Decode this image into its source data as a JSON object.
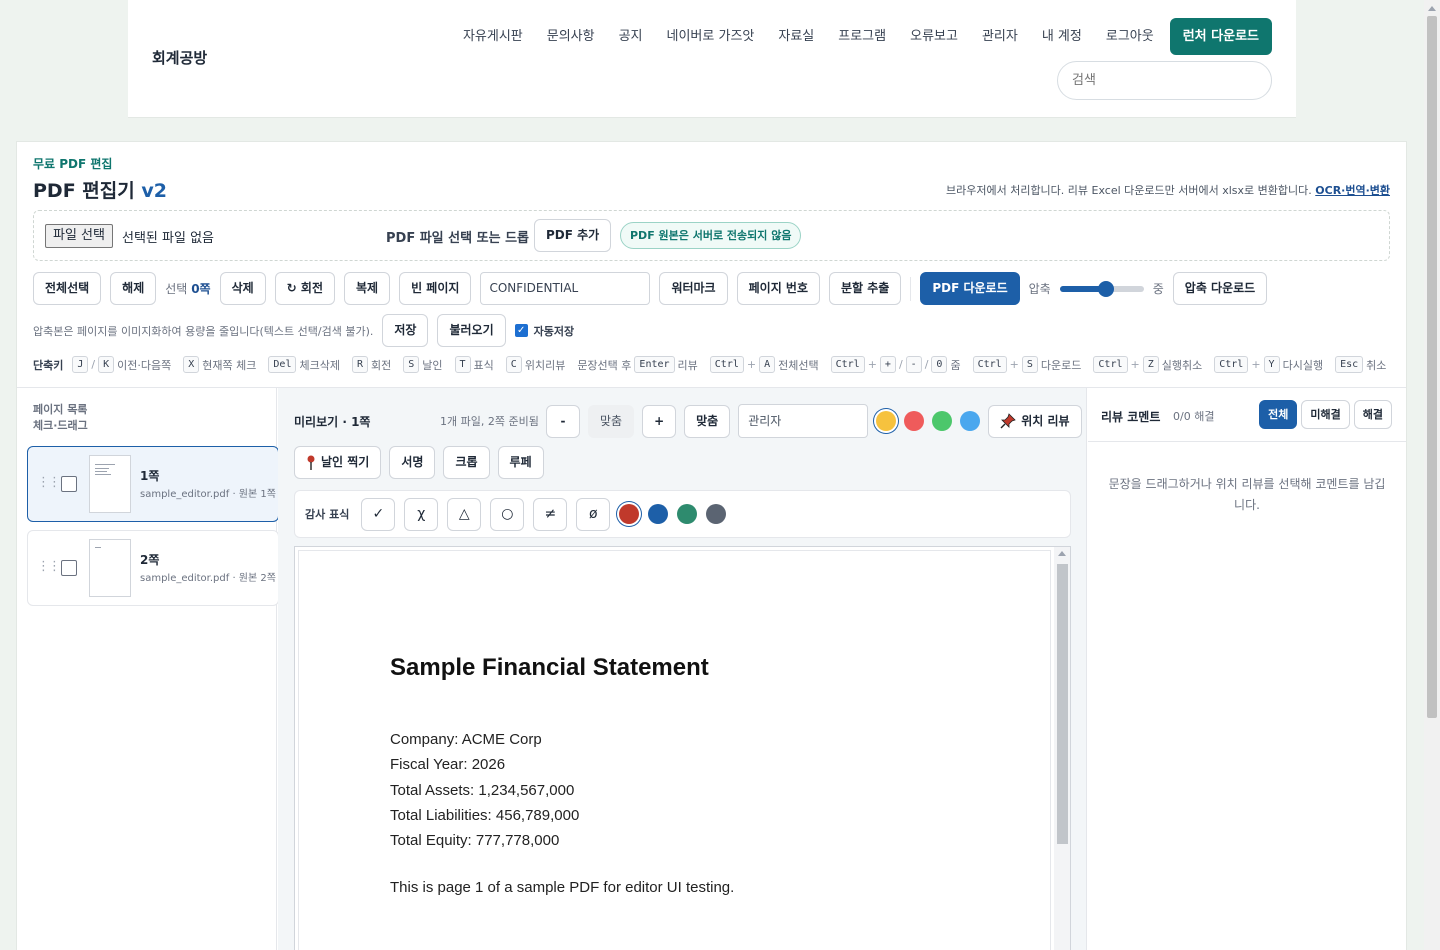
{
  "site": {
    "brand": "회계공방",
    "nav": [
      "자유게시판",
      "문의사항",
      "공지",
      "네이버로 가즈앗",
      "자료실",
      "프로그램",
      "오류보고",
      "관리자",
      "내 계정",
      "로그아웃"
    ],
    "cta": "런처 다운로드",
    "search_placeholder": "검색"
  },
  "header": {
    "eyebrow": "무료 PDF 편집",
    "title": "PDF 편집기",
    "version": "v2",
    "note": "브라우저에서 처리합니다. 리뷰 Excel 다운로드만 서버에서 xlsx로 변환합니다.",
    "note_link": "OCR·번역·변환"
  },
  "dropzone": {
    "file_button": "파일 선택",
    "file_status": "선택된 파일 없음",
    "label": "PDF 파일 선택 또는 드롭",
    "add_button": "PDF 추가",
    "secure_badge": "PDF 원본은 서버로 전송되지 않음"
  },
  "toolbar": {
    "select_all": "전체선택",
    "deselect": "해제",
    "selected_prefix": "선택",
    "selected_count": "0쪽",
    "delete": "삭제",
    "rotate": "↻ 회전",
    "duplicate": "복제",
    "blank_page": "빈 페이지",
    "watermark_value": "CONFIDENTIAL",
    "watermark": "워터마크",
    "page_number": "페이지 번호",
    "split": "분할 추출",
    "download": "PDF 다운로드",
    "compress_label": "압축",
    "compress_value": 0.55,
    "compress_level": "중",
    "compress_download": "압축 다운로드",
    "compress_note": "압축본은 페이지를 이미지화하여 용량을 줄입니다(텍스트 선택/검색 불가).",
    "save": "저장",
    "load": "불러오기",
    "autosave": "자동저장",
    "autosave_checked": true
  },
  "shortcuts": {
    "label": "단축키",
    "items": [
      {
        "keys": [
          "J",
          "K"
        ],
        "joiner": "/",
        "text": "이전·다음쪽"
      },
      {
        "keys": [
          "X"
        ],
        "text": "현재쪽 체크"
      },
      {
        "keys": [
          "Del"
        ],
        "text": "체크삭제"
      },
      {
        "keys": [
          "R"
        ],
        "text": "회전"
      },
      {
        "keys": [
          "S"
        ],
        "text": "날인"
      },
      {
        "keys": [
          "T"
        ],
        "text": "표식"
      },
      {
        "keys": [
          "C"
        ],
        "text": "위치리뷰"
      },
      {
        "prefix": "문장선택 후",
        "keys": [
          "Enter"
        ],
        "text": "리뷰"
      },
      {
        "keys": [
          "Ctrl",
          "A"
        ],
        "joiner": "+",
        "text": "전체선택"
      },
      {
        "keys": [
          "Ctrl",
          "+",
          "-",
          "0"
        ],
        "joiner": "+//",
        "text": "줌"
      },
      {
        "keys": [
          "Ctrl",
          "S"
        ],
        "joiner": "+",
        "text": "다운로드"
      },
      {
        "keys": [
          "Ctrl",
          "Z"
        ],
        "joiner": "+",
        "text": "실행취소"
      },
      {
        "keys": [
          "Ctrl",
          "Y"
        ],
        "joiner": "+",
        "text": "다시실행"
      },
      {
        "keys": [
          "Esc"
        ],
        "text": "취소"
      }
    ]
  },
  "pages_panel": {
    "title": "페이지 목록",
    "subtitle": "체크·드래그",
    "pages": [
      {
        "name": "1쪽",
        "sub": "sample_editor.pdf · 원본 1쪽",
        "active": true
      },
      {
        "name": "2쪽",
        "sub": "sample_editor.pdf · 원본 2쪽",
        "active": false
      }
    ]
  },
  "preview": {
    "title": "미리보기 · 1쪽",
    "status": "1개 파일, 2쪽 준비됨",
    "zoom_out": "-",
    "fit": "맞춤",
    "zoom_in": "+",
    "fit2": "맞춤",
    "reviewer": "관리자",
    "colors": [
      "#f6c23e",
      "#ef5b5b",
      "#4cc76b",
      "#4aa7ee"
    ],
    "pin_review": "위치 리뷰",
    "tools": [
      "날인 찍기",
      "서명",
      "크롭",
      "루페"
    ],
    "audit_label": "감사 표식",
    "audit_marks": [
      "✓",
      "χ",
      "△",
      "○",
      "≠",
      "ø"
    ],
    "audit_colors": [
      "#c0392b",
      "#1d5fa8",
      "#2e8b6e",
      "#5b6472"
    ]
  },
  "document": {
    "title": "Sample Financial Statement",
    "lines": [
      "Company: ACME Corp",
      "Fiscal Year: 2026",
      "Total Assets: 1,234,567,000",
      "Total Liabilities: 456,789,000",
      "Total Equity: 777,778,000"
    ],
    "footer": "This is page 1 of a sample PDF for editor UI testing."
  },
  "review_panel": {
    "title": "리뷰 코멘트",
    "count": "0/0 해결",
    "filters": [
      "전체",
      "미해결",
      "해결"
    ],
    "empty": "문장을 드래그하거나 위치 리뷰를 선택해 코멘트를 남깁니다."
  }
}
